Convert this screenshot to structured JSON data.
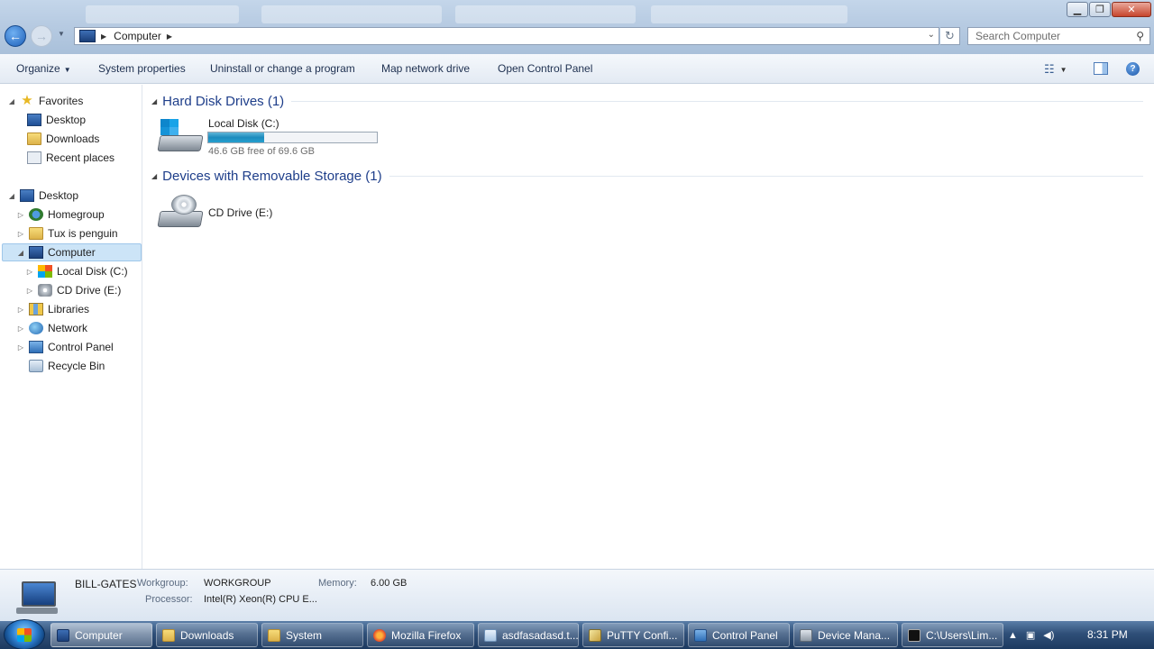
{
  "address_bar": {
    "crumbs": [
      "Computer"
    ]
  },
  "search": {
    "placeholder": "Search Computer"
  },
  "commandbar": {
    "organize": "Organize",
    "system_properties": "System properties",
    "uninstall": "Uninstall or change a program",
    "map_drive": "Map network drive",
    "open_control_panel": "Open Control Panel"
  },
  "nav": {
    "favorites": "Favorites",
    "fav_desktop": "Desktop",
    "fav_downloads": "Downloads",
    "fav_recent": "Recent places",
    "desktop": "Desktop",
    "homegroup": "Homegroup",
    "tux": "Tux is penguin",
    "computer": "Computer",
    "local_disk": "Local Disk (C:)",
    "cd_drive": "CD Drive (E:)",
    "libraries": "Libraries",
    "network": "Network",
    "control_panel": "Control Panel",
    "recycle_bin": "Recycle Bin"
  },
  "groups": {
    "hdd_header": "Hard Disk Drives (1)",
    "removable_header": "Devices with Removable Storage (1)"
  },
  "drives": {
    "c": {
      "name": "Local Disk (C:)",
      "free_text": "46.6 GB free of 69.6 GB",
      "used_fraction": 0.33
    },
    "e": {
      "name": "CD Drive (E:)"
    }
  },
  "details": {
    "computer_name": "BILL-GATES",
    "workgroup_label": "Workgroup:",
    "workgroup_value": "WORKGROUP",
    "memory_label": "Memory:",
    "memory_value": "6.00 GB",
    "processor_label": "Processor:",
    "processor_value": "Intel(R) Xeon(R) CPU E..."
  },
  "taskbar": {
    "items": [
      "Computer",
      "Downloads",
      "System",
      "Mozilla Firefox",
      "asdfasadasd.t...",
      "PuTTY Confi...",
      "Control Panel",
      "Device Mana...",
      "C:\\Users\\Lim..."
    ],
    "clock": "8:31 PM"
  },
  "colors": {
    "group_header": "#1e3e8a",
    "selection": "#cce4f7",
    "usage_bar": "#1c8bbd",
    "taskbar": "#2f4f78"
  }
}
